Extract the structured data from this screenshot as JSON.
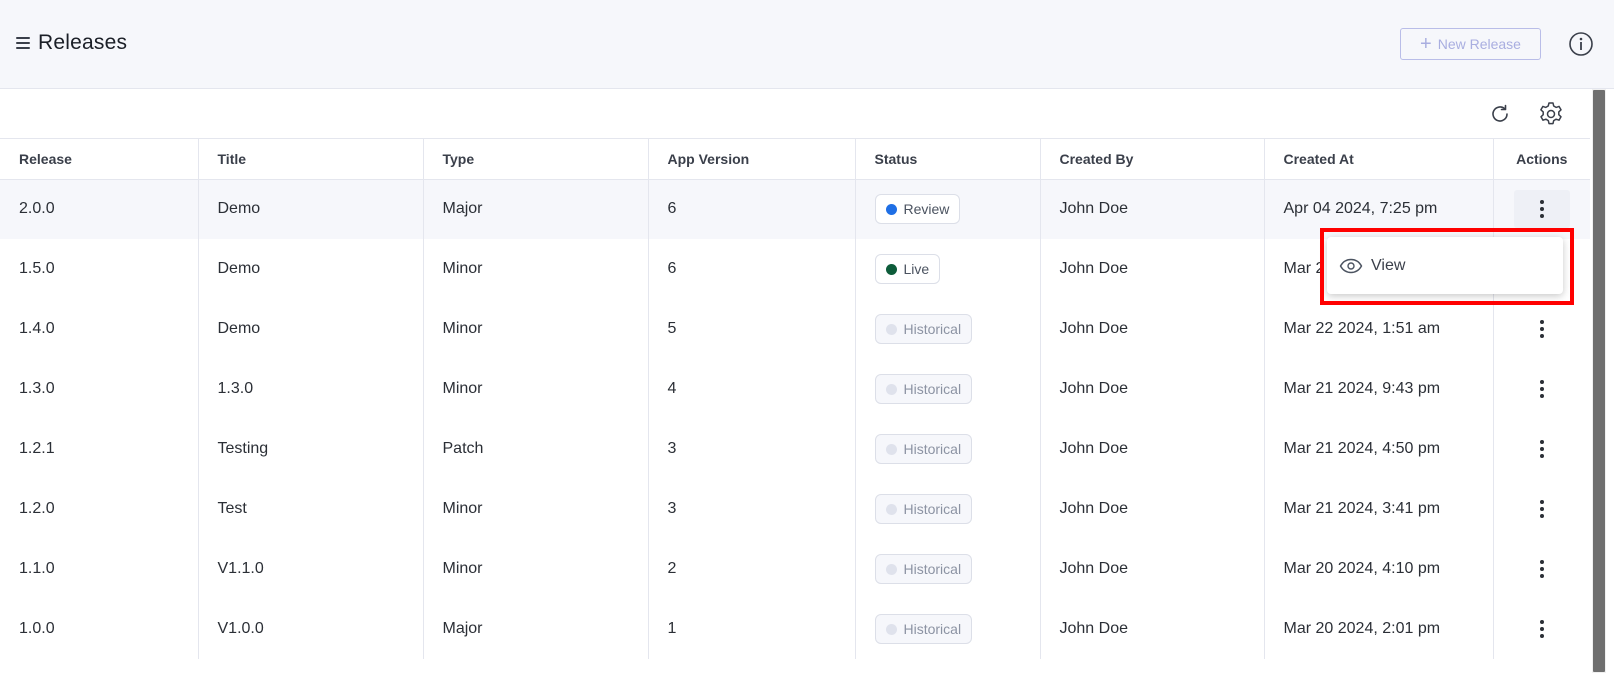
{
  "header": {
    "title": "Releases",
    "new_release_label": "New Release"
  },
  "table": {
    "columns": [
      "Release",
      "Title",
      "Type",
      "App Version",
      "Status",
      "Created By",
      "Created At",
      "Actions"
    ],
    "rows": [
      {
        "release": "2.0.0",
        "title": "Demo",
        "type": "Major",
        "app_version": "6",
        "status": "Review",
        "created_by": "John Doe",
        "created_at": "Apr 04 2024, 7:25 pm"
      },
      {
        "release": "1.5.0",
        "title": "Demo",
        "type": "Minor",
        "app_version": "6",
        "status": "Live",
        "created_by": "John Doe",
        "created_at": "Mar 2"
      },
      {
        "release": "1.4.0",
        "title": "Demo",
        "type": "Minor",
        "app_version": "5",
        "status": "Historical",
        "created_by": "John Doe",
        "created_at": "Mar 22 2024, 1:51 am"
      },
      {
        "release": "1.3.0",
        "title": "1.3.0",
        "type": "Minor",
        "app_version": "4",
        "status": "Historical",
        "created_by": "John Doe",
        "created_at": "Mar 21 2024, 9:43 pm"
      },
      {
        "release": "1.2.1",
        "title": "Testing",
        "type": "Patch",
        "app_version": "3",
        "status": "Historical",
        "created_by": "John Doe",
        "created_at": "Mar 21 2024, 4:50 pm"
      },
      {
        "release": "1.2.0",
        "title": "Test",
        "type": "Minor",
        "app_version": "3",
        "status": "Historical",
        "created_by": "John Doe",
        "created_at": "Mar 21 2024, 3:41 pm"
      },
      {
        "release": "1.1.0",
        "title": "V1.1.0",
        "type": "Minor",
        "app_version": "2",
        "status": "Historical",
        "created_by": "John Doe",
        "created_at": "Mar 20 2024, 4:10 pm"
      },
      {
        "release": "1.0.0",
        "title": "V1.0.0",
        "type": "Major",
        "app_version": "1",
        "status": "Historical",
        "created_by": "John Doe",
        "created_at": "Mar 20 2024, 2:01 pm"
      }
    ]
  },
  "dropdown": {
    "view_label": "View"
  },
  "colors": {
    "review_dot": "#1f6fe5",
    "live_dot": "#0d5c3a",
    "historical_dot": "#dfe2ec",
    "highlight": "#ff0000"
  }
}
